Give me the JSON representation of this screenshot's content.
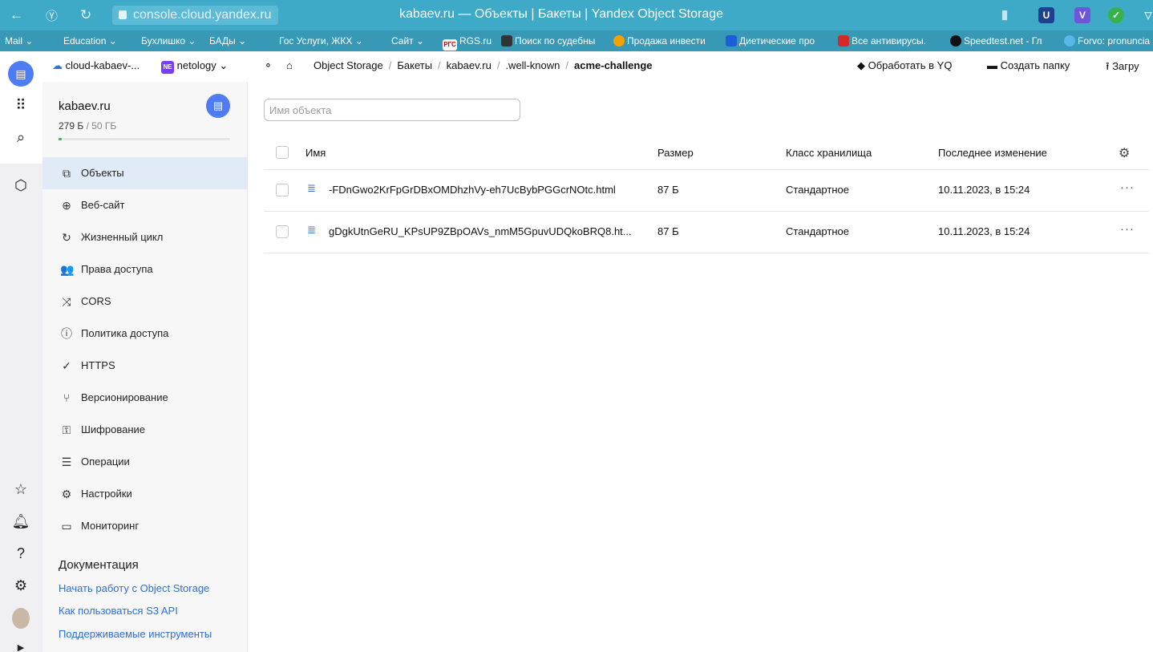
{
  "browser": {
    "url": "console.cloud.yandex.ru",
    "window_title": "kabaev.ru — Объекты | Бакеты | Yandex Object Storage",
    "extensions": [
      "V",
      "✓"
    ]
  },
  "bookmarks": [
    {
      "label": "Mail ⌄"
    },
    {
      "label": "Education ⌄"
    },
    {
      "label": "Бухлишко ⌄"
    },
    {
      "label": "БАДы ⌄"
    },
    {
      "label": "Гос Услуги, ЖКХ ⌄"
    },
    {
      "label": "Сайт ⌄"
    },
    {
      "label": "RGS.ru"
    },
    {
      "label": "Поиск по судебны"
    },
    {
      "label": "Продажа инвести"
    },
    {
      "label": "Диетические про"
    },
    {
      "label": "Все антивирусы."
    },
    {
      "label": "Speedtest.net - Гл"
    },
    {
      "label": "Forvo: pronuncia"
    }
  ],
  "appbar": {
    "cloud": "cloud-kabaev-...",
    "folder_badge": "NE",
    "folder": "netology",
    "breadcrumbs": [
      "Object Storage",
      "Бакеты",
      "kabaev.ru",
      ".well-known",
      "acme-challenge"
    ],
    "actions": {
      "yq": "Обработать в YQ",
      "create_folder": "Создать папку",
      "upload": "Загру"
    }
  },
  "bucket": {
    "name": "kabaev.ru",
    "used": "279 Б",
    "total": " / 50 ГБ",
    "usage_fraction": 0.01
  },
  "menu": [
    {
      "label": "Объекты",
      "icon": "objects-icon",
      "glyph": "⧉",
      "active": true
    },
    {
      "label": "Веб-сайт",
      "icon": "globe-icon",
      "glyph": "⊕"
    },
    {
      "label": "Жизненный цикл",
      "icon": "lifecycle-icon",
      "glyph": "↻"
    },
    {
      "label": "Права доступа",
      "icon": "users-icon",
      "glyph": "👥"
    },
    {
      "label": "CORS",
      "icon": "cors-icon",
      "glyph": "⤨"
    },
    {
      "label": "Политика доступа",
      "icon": "policy-icon",
      "glyph": "ⓘ"
    },
    {
      "label": "HTTPS",
      "icon": "https-icon",
      "glyph": "✓"
    },
    {
      "label": "Версионирование",
      "icon": "versioning-icon",
      "glyph": "⑂"
    },
    {
      "label": "Шифрование",
      "icon": "encryption-icon",
      "glyph": "⚿"
    },
    {
      "label": "Операции",
      "icon": "operations-icon",
      "glyph": "☰"
    },
    {
      "label": "Настройки",
      "icon": "settings-icon",
      "glyph": "⚙"
    },
    {
      "label": "Мониторинг",
      "icon": "monitoring-icon",
      "glyph": "▭"
    }
  ],
  "docs": {
    "title": "Документация",
    "links": [
      "Начать работу с Object Storage",
      "Как пользоваться S3 API",
      "Поддерживаемые инструменты"
    ]
  },
  "search": {
    "placeholder": "Имя объекта",
    "value": ""
  },
  "table": {
    "columns": [
      "Имя",
      "Размер",
      "Класс хранилища",
      "Последнее изменение"
    ],
    "rows": [
      {
        "name": "-FDnGwo2KrFpGrDBxOMDhzhVy-eh7UcBybPGGcrNOtc.html",
        "size": "87 Б",
        "class": "Стандартное",
        "modified": "10.11.2023, в 15:24",
        "more": "···"
      },
      {
        "name": "gDgkUtnGeRU_KPsUP9ZBpOAVs_nmM5GpuvUDQkoBRQ8.ht...",
        "size": "87 Б",
        "class": "Стандартное",
        "modified": "10.11.2023, в 15:24",
        "more": "···"
      }
    ]
  },
  "colors": {
    "accent": "#4d7cf4",
    "link": "#2c6fd9",
    "titlebar": "#3fa9c8",
    "active_menu": "#e1eaf7"
  }
}
